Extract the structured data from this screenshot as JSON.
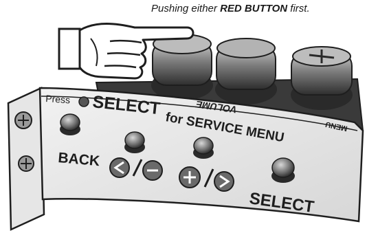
{
  "caption": {
    "prefix": "Pushing either ",
    "emphasis": "RED BUTTON",
    "suffix": " first."
  },
  "panel": {
    "volume_label": "VOLUME",
    "menu_label": "MENU",
    "press": "Press",
    "select_word": "SELECT",
    "for_service_menu": "for SERVICE MENU",
    "back": "BACK",
    "select": "SELECT"
  },
  "colors": {
    "ink": "#1e1e1e",
    "panel": "#e8e8e8",
    "cap": "#8a8a8a"
  }
}
